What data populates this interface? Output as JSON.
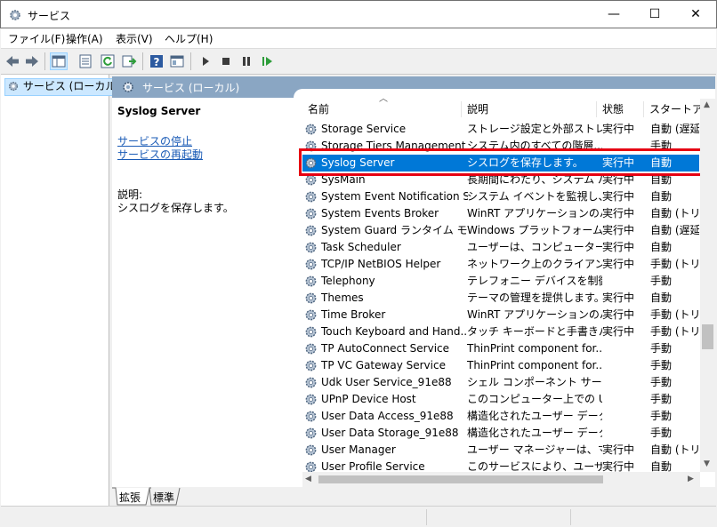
{
  "window": {
    "title": "サービス",
    "minimize_glyph": "—",
    "maximize_glyph": "☐",
    "close_glyph": "✕"
  },
  "menu": [
    "ファイル(F)",
    "操作(A)",
    "表示(V)",
    "ヘルプ(H)"
  ],
  "toolbar_icons": [
    "back-arrow-icon",
    "forward-arrow-icon",
    "console-tree-icon",
    "properties-icon",
    "refresh-icon",
    "export-icon",
    "help-icon",
    "view-icon",
    "play-icon",
    "stop-icon",
    "pause-icon",
    "restart-icon"
  ],
  "tree": {
    "item_label": "サービス (ローカル)"
  },
  "panel": {
    "header": "サービス (ローカル)"
  },
  "extended": {
    "service_name": "Syslog Server",
    "stop_link": "サービスの停止",
    "restart_link": "サービスの再起動",
    "desc_label": "説明:",
    "desc_text": "シスログを保存します。"
  },
  "columns": [
    "名前",
    "説明",
    "状態",
    "スタートアッ"
  ],
  "rows": [
    {
      "name": "Storage Service",
      "desc": "ストレージ設定と外部ストレ...",
      "status": "実行中",
      "startup": "自動 (遅延"
    },
    {
      "name": "Storage Tiers Management",
      "desc": "システム内のすべての階層...",
      "status": "",
      "startup": "手動"
    },
    {
      "name": "Syslog Server",
      "desc": "シスログを保存します。",
      "status": "実行中",
      "startup": "自動",
      "selected": true
    },
    {
      "name": "SysMain",
      "desc": "長期間にわたり、システム パ...",
      "status": "実行中",
      "startup": "自動"
    },
    {
      "name": "System Event Notification S...",
      "desc": "システム イベントを監視し、...",
      "status": "実行中",
      "startup": "自動"
    },
    {
      "name": "System Events Broker",
      "desc": "WinRT アプリケーションのバ...",
      "status": "実行中",
      "startup": "自動 (トリガ"
    },
    {
      "name": "System Guard ランタイム モニ...",
      "desc": "Windows プラットフォームの...",
      "status": "実行中",
      "startup": "自動 (遅延"
    },
    {
      "name": "Task Scheduler",
      "desc": "ユーザーは、コンピューターの...",
      "status": "実行中",
      "startup": "自動"
    },
    {
      "name": "TCP/IP NetBIOS Helper",
      "desc": "ネットワーク上のクライアント...",
      "status": "実行中",
      "startup": "手動 (トリガ"
    },
    {
      "name": "Telephony",
      "desc": "テレフォニー デバイスを制御...",
      "status": "",
      "startup": "手動"
    },
    {
      "name": "Themes",
      "desc": "テーマの管理を提供します。",
      "status": "実行中",
      "startup": "自動"
    },
    {
      "name": "Time Broker",
      "desc": "WinRT アプリケーションのバ...",
      "status": "実行中",
      "startup": "手動 (トリガ"
    },
    {
      "name": "Touch Keyboard and Hand...",
      "desc": "タッチ キーボードと手書きパ...",
      "status": "実行中",
      "startup": "手動 (トリガ"
    },
    {
      "name": "TP AutoConnect Service",
      "desc": "ThinPrint component for...",
      "status": "",
      "startup": "手動"
    },
    {
      "name": "TP VC Gateway Service",
      "desc": "ThinPrint component for...",
      "status": "",
      "startup": "手動"
    },
    {
      "name": "Udk User Service_91e88",
      "desc": "シェル コンポーネント サービス",
      "status": "",
      "startup": "手動"
    },
    {
      "name": "UPnP Device Host",
      "desc": "このコンピューター上での UP...",
      "status": "",
      "startup": "手動"
    },
    {
      "name": "User Data Access_91e88",
      "desc": "構造化されたユーザー データ...",
      "status": "",
      "startup": "手動"
    },
    {
      "name": "User Data Storage_91e88",
      "desc": "構造化されたユーザー データ...",
      "status": "",
      "startup": "手動"
    },
    {
      "name": "User Manager",
      "desc": "ユーザー マネージャーは、マル...",
      "status": "実行中",
      "startup": "自動 (トリガ"
    },
    {
      "name": "User Profile Service",
      "desc": "このサービスにより、ユーザー...",
      "status": "実行中",
      "startup": "自動"
    }
  ],
  "tabs": [
    "拡張",
    "標準"
  ],
  "colors": {
    "selection": "#0078d7",
    "highlight_box": "#e60012",
    "panel_header": "#8aa6c3",
    "link": "#1a5bb6"
  }
}
